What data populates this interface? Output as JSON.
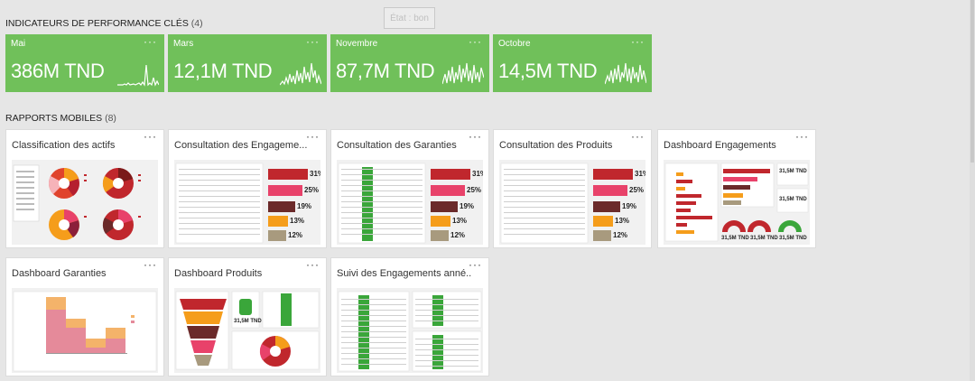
{
  "kpi_section": {
    "title": "INDICATEURS DE PERFORMANCE CLÉS",
    "count": "(4)"
  },
  "state_button": "État : bon",
  "kpis": [
    {
      "name": "Mai",
      "value": "386M TND",
      "menu": "···"
    },
    {
      "name": "Mars",
      "value": "12,1M TND",
      "menu": "···"
    },
    {
      "name": "Novembre",
      "value": "87,7M TND",
      "menu": "···"
    },
    {
      "name": "Octobre",
      "value": "14,5M TND",
      "menu": "···"
    }
  ],
  "reports_section": {
    "title": "RAPPORTS MOBILES",
    "count": "(8)"
  },
  "reports": [
    {
      "title": "Classification des actifs",
      "menu": "···"
    },
    {
      "title": "Consultation des Engageme...",
      "menu": "···"
    },
    {
      "title": "Consultation des Garanties",
      "menu": "···"
    },
    {
      "title": "Consultation des Produits",
      "menu": "···"
    },
    {
      "title": "Dashboard Engagements",
      "menu": "···"
    },
    {
      "title": "Dashboard Garanties",
      "menu": "···"
    },
    {
      "title": "Dashboard Produits",
      "menu": "···"
    },
    {
      "title": "Suivi des Engagements anné...",
      "menu": "···"
    }
  ],
  "thumb_labels": {
    "pct": [
      "31%",
      "25%",
      "19%",
      "13%",
      "12%"
    ],
    "eng_gauges": [
      "31,5M TND",
      "31,5M TND",
      "31,5M TND"
    ],
    "eng_values": [
      "31,5M TND",
      "31,5M TND"
    ],
    "prod_value": "31,5M TND"
  },
  "colors": {
    "kpi_green": "#70c05a",
    "accent_red": "#c0272d",
    "pink": "#e8426a",
    "brown": "#6b2a2a",
    "orange": "#f59d1b"
  }
}
